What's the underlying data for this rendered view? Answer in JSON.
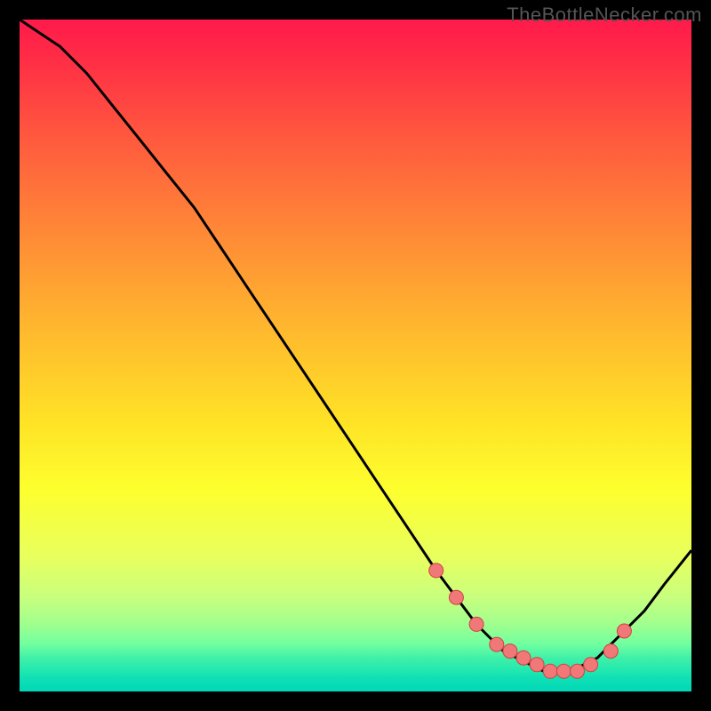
{
  "watermark": "TheBottleNecker.com",
  "colors": {
    "curve": "#000000",
    "dot_fill": "#f07878",
    "dot_stroke": "#d44040"
  },
  "chart_data": {
    "type": "line",
    "title": "",
    "xlabel": "",
    "ylabel": "",
    "xlim": [
      0,
      100
    ],
    "ylim": [
      0,
      100
    ],
    "x": [
      0,
      3,
      6,
      10,
      14,
      18,
      22,
      26,
      30,
      34,
      38,
      42,
      46,
      50,
      54,
      58,
      62,
      65,
      68,
      70,
      72,
      74,
      76,
      78,
      80,
      82,
      84,
      86,
      88,
      90,
      93,
      96,
      100
    ],
    "y": [
      100,
      98,
      96,
      92,
      87,
      82,
      77,
      72,
      66,
      60,
      54,
      48,
      42,
      36,
      30,
      24,
      18,
      14,
      10,
      8,
      6,
      5,
      4,
      3,
      3,
      3,
      4,
      5,
      7,
      9,
      12,
      16,
      21
    ],
    "dots_x": [
      62,
      65,
      68,
      71,
      73,
      75,
      77,
      79,
      81,
      83,
      85,
      88,
      90
    ],
    "dots_y": [
      18,
      14,
      10,
      7,
      6,
      5,
      4,
      3,
      3,
      3,
      4,
      6,
      9
    ]
  }
}
